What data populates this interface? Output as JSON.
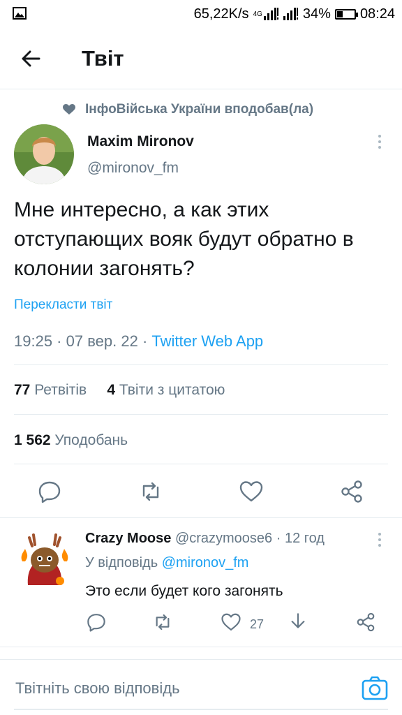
{
  "status_bar": {
    "network_speed": "65,22K/s",
    "network_type": "4G",
    "battery_percent": "34%",
    "battery_level": 0.34,
    "time": "08:24"
  },
  "header": {
    "title": "Твіт",
    "back_icon": "arrow-left-icon"
  },
  "tweet": {
    "liked_by": "ІнфоВійська України вподобав(ла)",
    "author_name": "Maxim Mironov",
    "author_handle": "@mironov_fm",
    "text": "Мне интересно, а как этих отступающих вояк будут обратно в колонии загонять?",
    "translate_label": "Перекласти твіт",
    "time": "19:25",
    "date": "07 вер. 22",
    "source": "Twitter Web App",
    "retweets_count": "77",
    "retweets_label": "Ретвітів",
    "quotes_count": "4",
    "quotes_label": "Твіти з цитатою",
    "likes_count": "1 562",
    "likes_label": "Уподобань"
  },
  "reply": {
    "author_name": "Crazy Moose",
    "author_handle": "@crazymoose6",
    "time": "12 год",
    "replying_to_label": "У відповідь",
    "replying_to_handle": "@mironov_fm",
    "text": "Это если будет кого загонять",
    "like_count": "27"
  },
  "compose": {
    "placeholder": "Твітніть свою відповідь"
  },
  "colors": {
    "accent": "#1da1f2",
    "secondary_text": "#657786",
    "primary_text": "#14171a",
    "divider": "#e6ecf0"
  }
}
